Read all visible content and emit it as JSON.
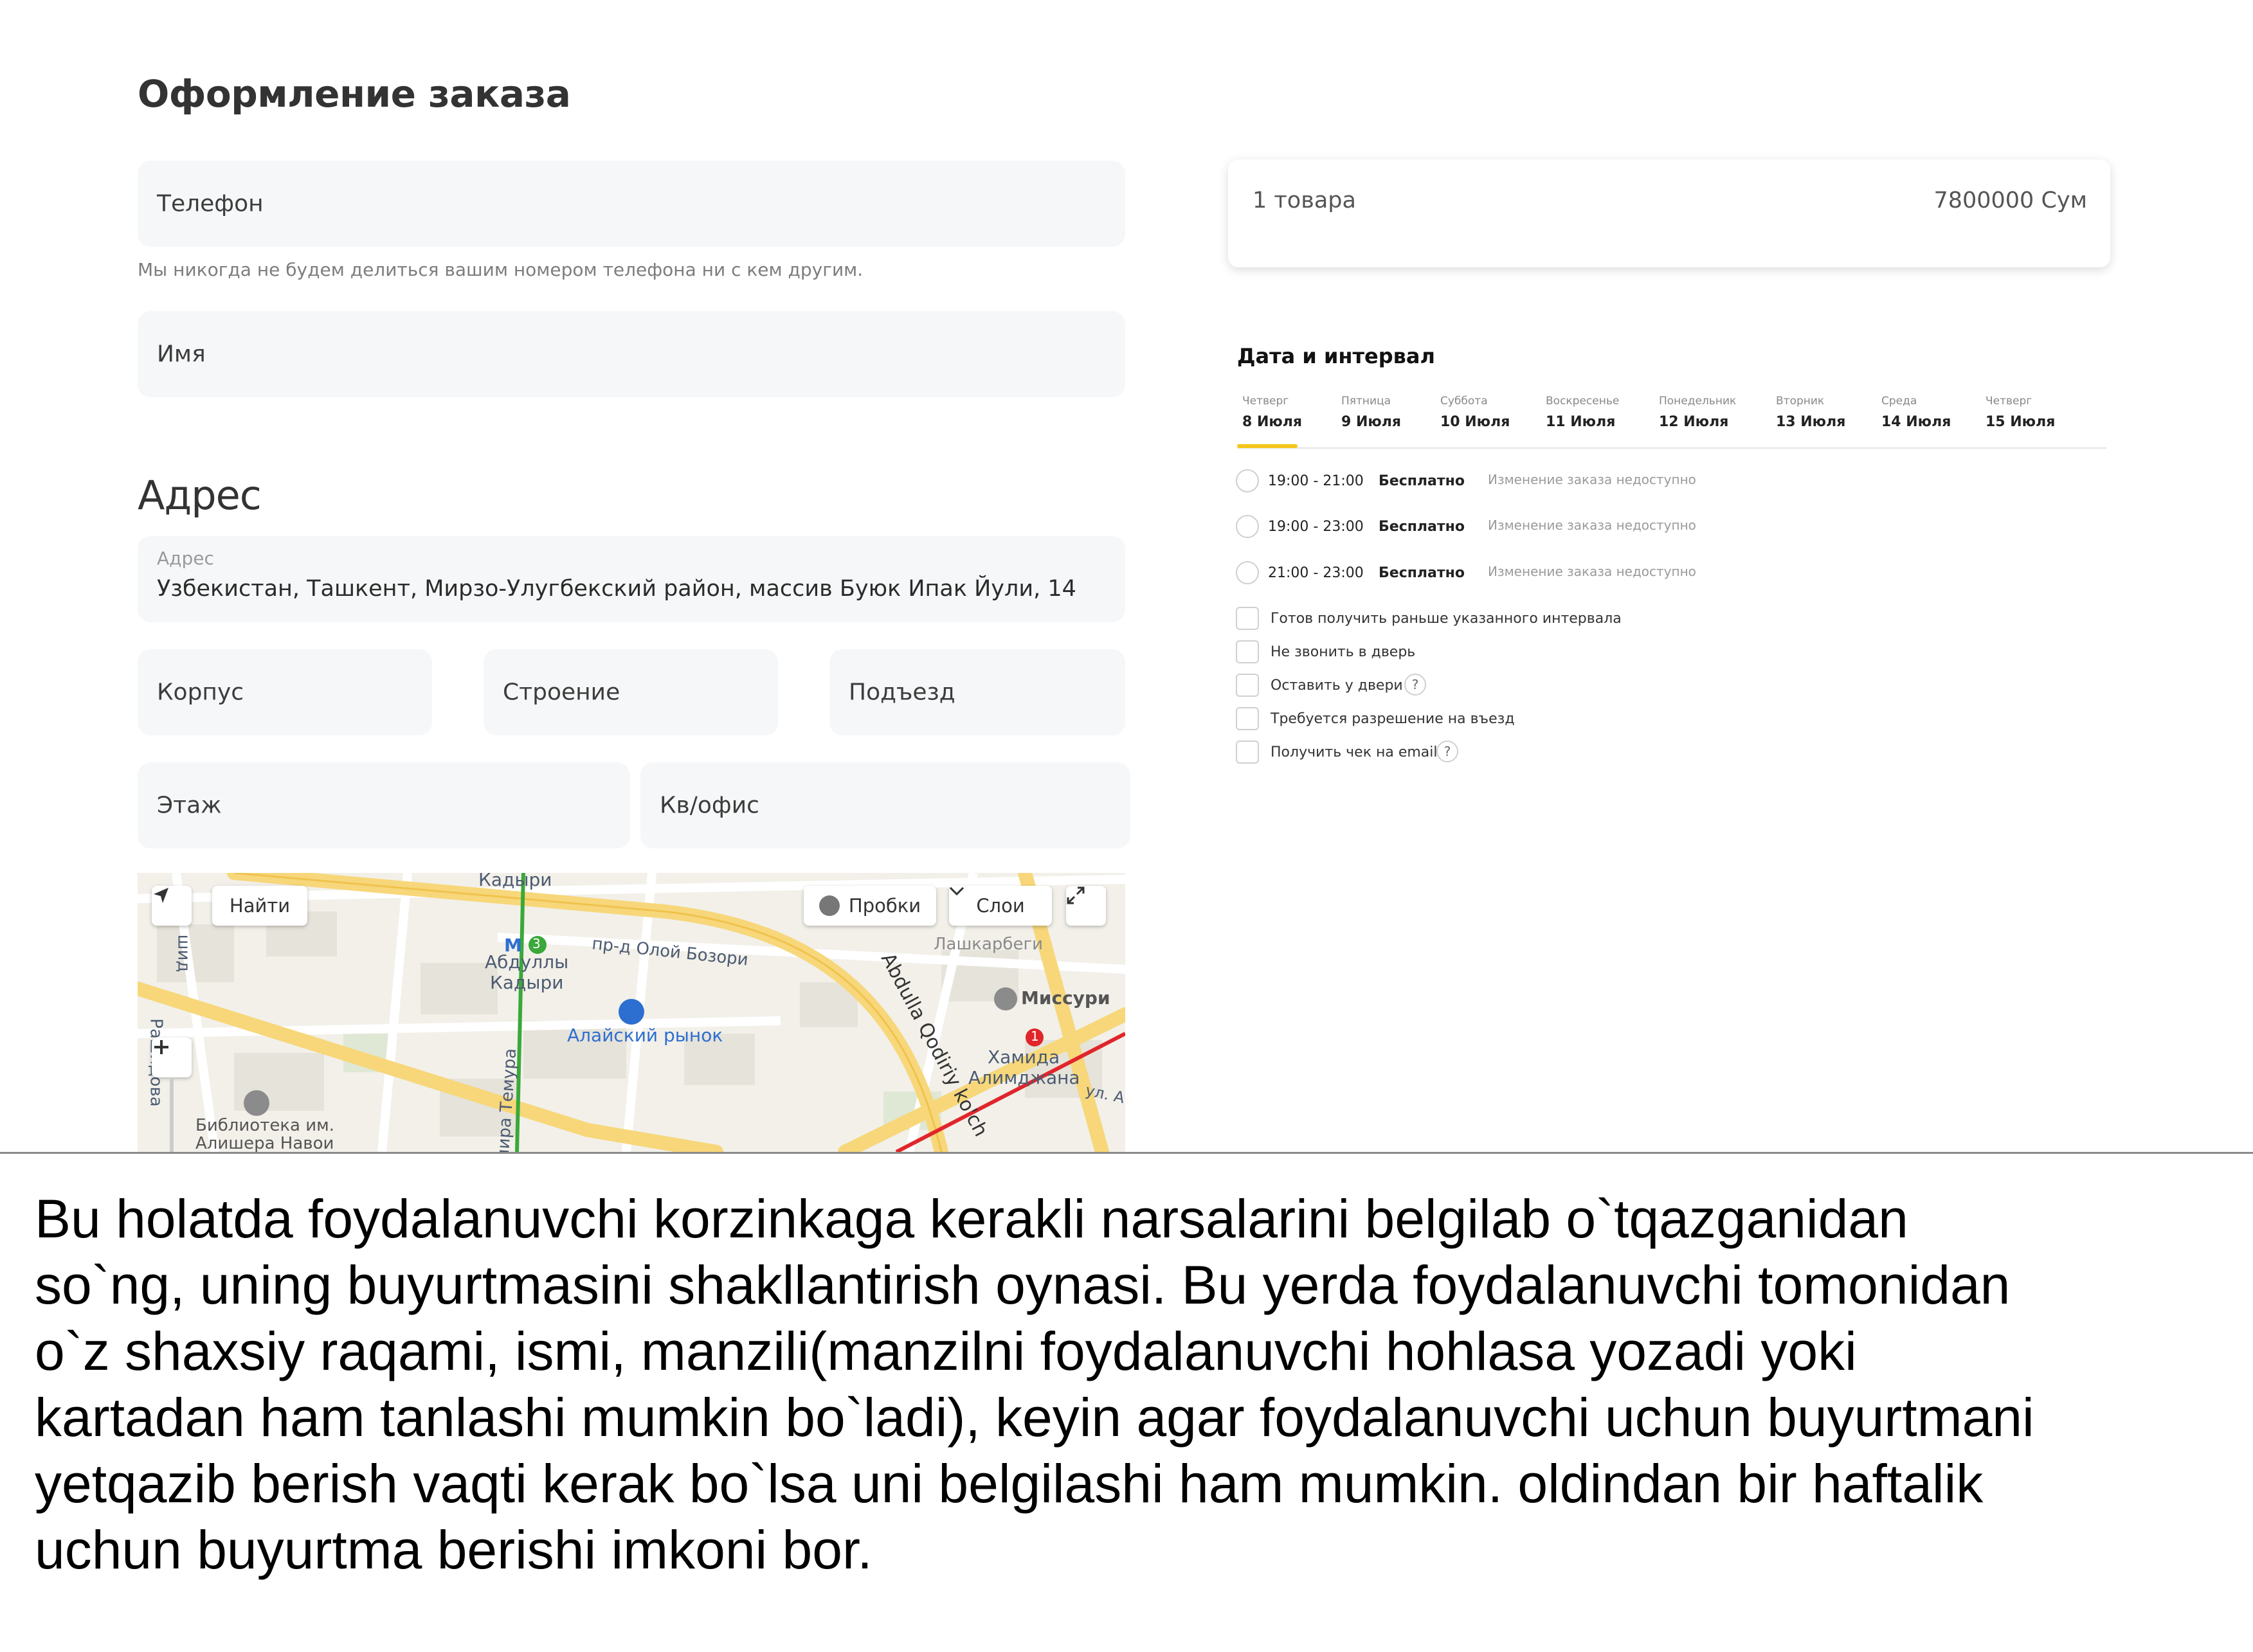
{
  "form": {
    "title": "Оформление заказа",
    "phone_placeholder": "Телефон",
    "phone_hint": "Мы никогда не будем делиться вашим номером телефона ни с кем другим.",
    "name_placeholder": "Имя"
  },
  "address": {
    "title": "Адрес",
    "field_label": "Адрес",
    "field_value": "Узбекистан, Ташкент, Мирзо-Улугбекский район, массив Буюк Ипак Йули, 14",
    "korpus": "Корпус",
    "stroenie": "Строение",
    "podezd": "Подъезд",
    "etazh": "Этаж",
    "kv": "Кв/офис"
  },
  "map": {
    "find_button": "Найти",
    "traffic_button": "Пробки",
    "layers_button": "Слои",
    "labels": {
      "top_street": "Кадыри",
      "street_olloy": "пр-д Олой Бозори",
      "metro_abdully_1": "Абдуллы",
      "metro_abdully_2": "Кадыри",
      "metro_abdully_line": "3",
      "alay_market": "Алайский рынок",
      "lashkarbegi": "Лашкарбеги",
      "missuri": "Миссури",
      "abdulla_road": "Abdulla Qodiriy ko'ch",
      "metro_hamida_1": "Хамида",
      "metro_hamida_2": "Алимджана",
      "metro_hamida_line": "1",
      "library_1": "Библиотека им.",
      "library_2": "Алишера Навои",
      "temura": "мира Темура",
      "left_street": "шид",
      "left_street_2": "Рашидова",
      "ul_a": "ул. А",
      "metro_letter": "М"
    }
  },
  "summary": {
    "count": "1 товара",
    "price": "7800000 Сум"
  },
  "delivery": {
    "title": "Дата и интервал",
    "days": [
      {
        "weekday": "Четверг",
        "date": "8 Июля"
      },
      {
        "weekday": "Пятница",
        "date": "9 Июля"
      },
      {
        "weekday": "Суббота",
        "date": "10 Июля"
      },
      {
        "weekday": "Воскресенье",
        "date": "11 Июля"
      },
      {
        "weekday": "Понедельник",
        "date": "12 Июля"
      },
      {
        "weekday": "Вторник",
        "date": "13 Июля"
      },
      {
        "weekday": "Среда",
        "date": "14 Июля"
      },
      {
        "weekday": "Четверг",
        "date": "15 Июля"
      }
    ],
    "selected_day": 0,
    "slots": [
      {
        "time": "19:00 - 21:00",
        "price": "Бесплатно",
        "note": "Изменение заказа недоступно"
      },
      {
        "time": "19:00 - 23:00",
        "price": "Бесплатно",
        "note": "Изменение заказа недоступно"
      },
      {
        "time": "21:00 - 23:00",
        "price": "Бесплатно",
        "note": "Изменение заказа недоступно"
      }
    ],
    "options": [
      {
        "label": "Готов получить раньше указанного интервала"
      },
      {
        "label": "Не звонить в дверь"
      },
      {
        "label": "Оставить у двери"
      },
      {
        "label": "Требуется разрешение на въезд"
      },
      {
        "label": "Получить чек на email"
      }
    ],
    "help_mark": "?"
  },
  "caption": {
    "lines": [
      "Bu holatda foydalanuvchi korzinkaga kerakli narsalarini belgilab o`tqazganidan",
      "so`ng, uning buyurtmasini shakllantirish oynasi. Bu yerda foydalanuvchi tomonidan",
      "o`z shaxsiy raqami, ismi, manzili(manzilni foydalanuvchi hohlasa yozadi yoki",
      "kartadan ham tanlashi mumkin bo`ladi), keyin agar foydalanuvchi uchun buyurtmani",
      "yetqazib berish vaqti kerak bo`lsa uni belgilashi ham mumkin. oldindan bir haftalik",
      "uchun buyurtma berishi imkoni bor."
    ]
  },
  "colors": {
    "accent_yellow": "#f5c518",
    "field_bg": "#f6f7f8",
    "metro_green": "#3aa83a",
    "metro_red": "#e0262b"
  }
}
